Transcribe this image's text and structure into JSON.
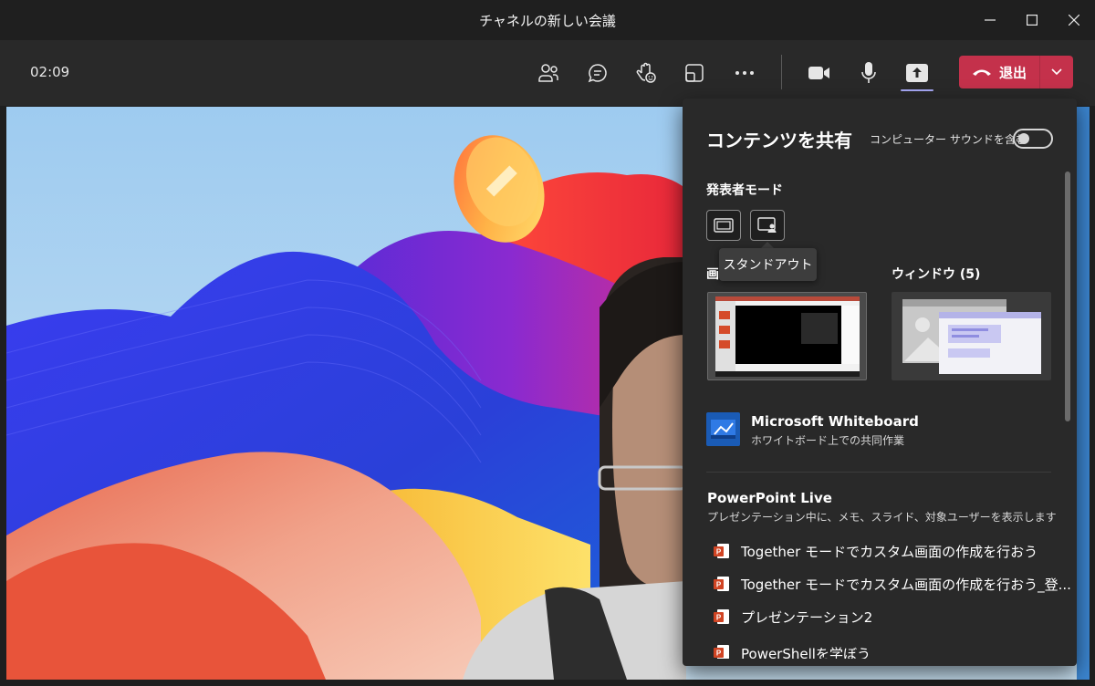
{
  "window": {
    "title": "チャネルの新しい会議"
  },
  "toolbar": {
    "timer": "02:09",
    "leave_label": "退出",
    "icons": [
      "participants-icon",
      "chat-icon",
      "raise-hand-icon",
      "rooms-icon",
      "more-icon",
      "camera-icon",
      "mic-icon",
      "share-icon"
    ]
  },
  "share_panel": {
    "title": "コンテンツを共有",
    "computer_sound_label": "コンピューター サウンドを含む",
    "computer_sound_on": false,
    "presenter_mode_label": "発表者モード",
    "tooltip": "スタンドアウト",
    "screen_label_partial": "画",
    "window_label": "ウィンドウ (5)",
    "whiteboard": {
      "title": "Microsoft Whiteboard",
      "subtitle": "ホワイトボード上での共同作業"
    },
    "powerpoint_live": {
      "title": "PowerPoint Live",
      "subtitle": "プレゼンテーション中に、メモ、スライド、対象ユーザーを表示します",
      "files": [
        "Together モードでカスタム画面の作成を行おう",
        "Together モードでカスタム画面の作成を行おう_登...",
        "プレゼンテーション2",
        "PowerShellを学ぼう"
      ]
    }
  },
  "colors": {
    "leave": "#c4314b",
    "accent": "#a7a9f5",
    "panel": "#292929"
  }
}
